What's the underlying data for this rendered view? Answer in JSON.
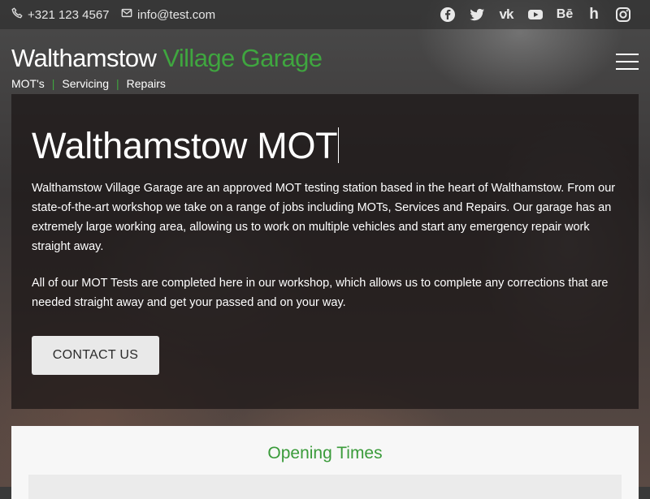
{
  "topbar": {
    "phone": "+321 123 4567",
    "email": "info@test.com",
    "socials": [
      "facebook-icon",
      "twitter-icon",
      "vk-icon",
      "youtube-icon",
      "behance-icon",
      "houzz-icon",
      "instagram-icon"
    ],
    "vk_text": "vk",
    "behance_text": "Bē",
    "houzz_text": "h"
  },
  "brand": {
    "title_part1": "Walthamstow",
    "title_part2": "Village Garage",
    "tag_items": [
      "MOT's",
      "Servicing",
      "Repairs"
    ],
    "separator": "|"
  },
  "hero": {
    "title": "Walthamstow MOT",
    "paragraph1": "Walthamstow Village Garage are an approved MOT testing station based in the heart of Walthamstow. From our state-of-the-art workshop we take on a range of jobs including MOTs, Services and Repairs. Our garage has an extremely large working area, allowing us to work on multiple vehicles and start any emergency repair work straight away.",
    "paragraph2": "All of our MOT Tests are completed here in our workshop, which allows us to complete any corrections that are needed straight away and get your passed and on your way.",
    "button_label": "CONTACT US"
  },
  "opening_times": {
    "title": "Opening Times"
  },
  "colors": {
    "brand_green": "#3fa63f",
    "button_bg": "#e9e9e9"
  }
}
